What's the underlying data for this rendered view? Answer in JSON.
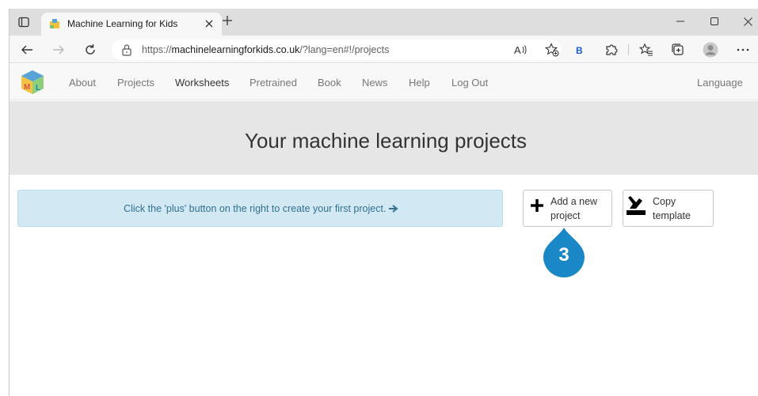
{
  "browser": {
    "tab_title": "Machine Learning for Kids",
    "url_prefix": "https://",
    "url_host": "machinelearningforkids.co.uk",
    "url_path": "/?lang=en#!/projects"
  },
  "nav": {
    "items": [
      "About",
      "Projects",
      "Worksheets",
      "Pretrained",
      "Book",
      "News",
      "Help",
      "Log Out"
    ],
    "language": "Language"
  },
  "main": {
    "title": "Your machine learning projects",
    "info": "Click the 'plus' button on the right to create your first project.",
    "add_button": "Add a new\nproject",
    "copy_button": "Copy\ntemplate",
    "step_number": "3"
  },
  "colors": {
    "accent_blue": "#1a87c6",
    "info_bg": "#d2e9f4",
    "info_text": "#31708f"
  },
  "icons": [
    "tab-actions-icon",
    "favicon-icon",
    "close-icon",
    "plus-icon",
    "minimize-icon",
    "maximize-icon",
    "back-icon",
    "forward-icon",
    "refresh-icon",
    "lock-icon",
    "read-aloud-icon",
    "add-favorite-icon",
    "bing-icon",
    "extensions-icon",
    "favorites-icon",
    "collections-icon",
    "profile-icon",
    "more-icon",
    "arrow-right-icon",
    "copy-template-icon"
  ]
}
